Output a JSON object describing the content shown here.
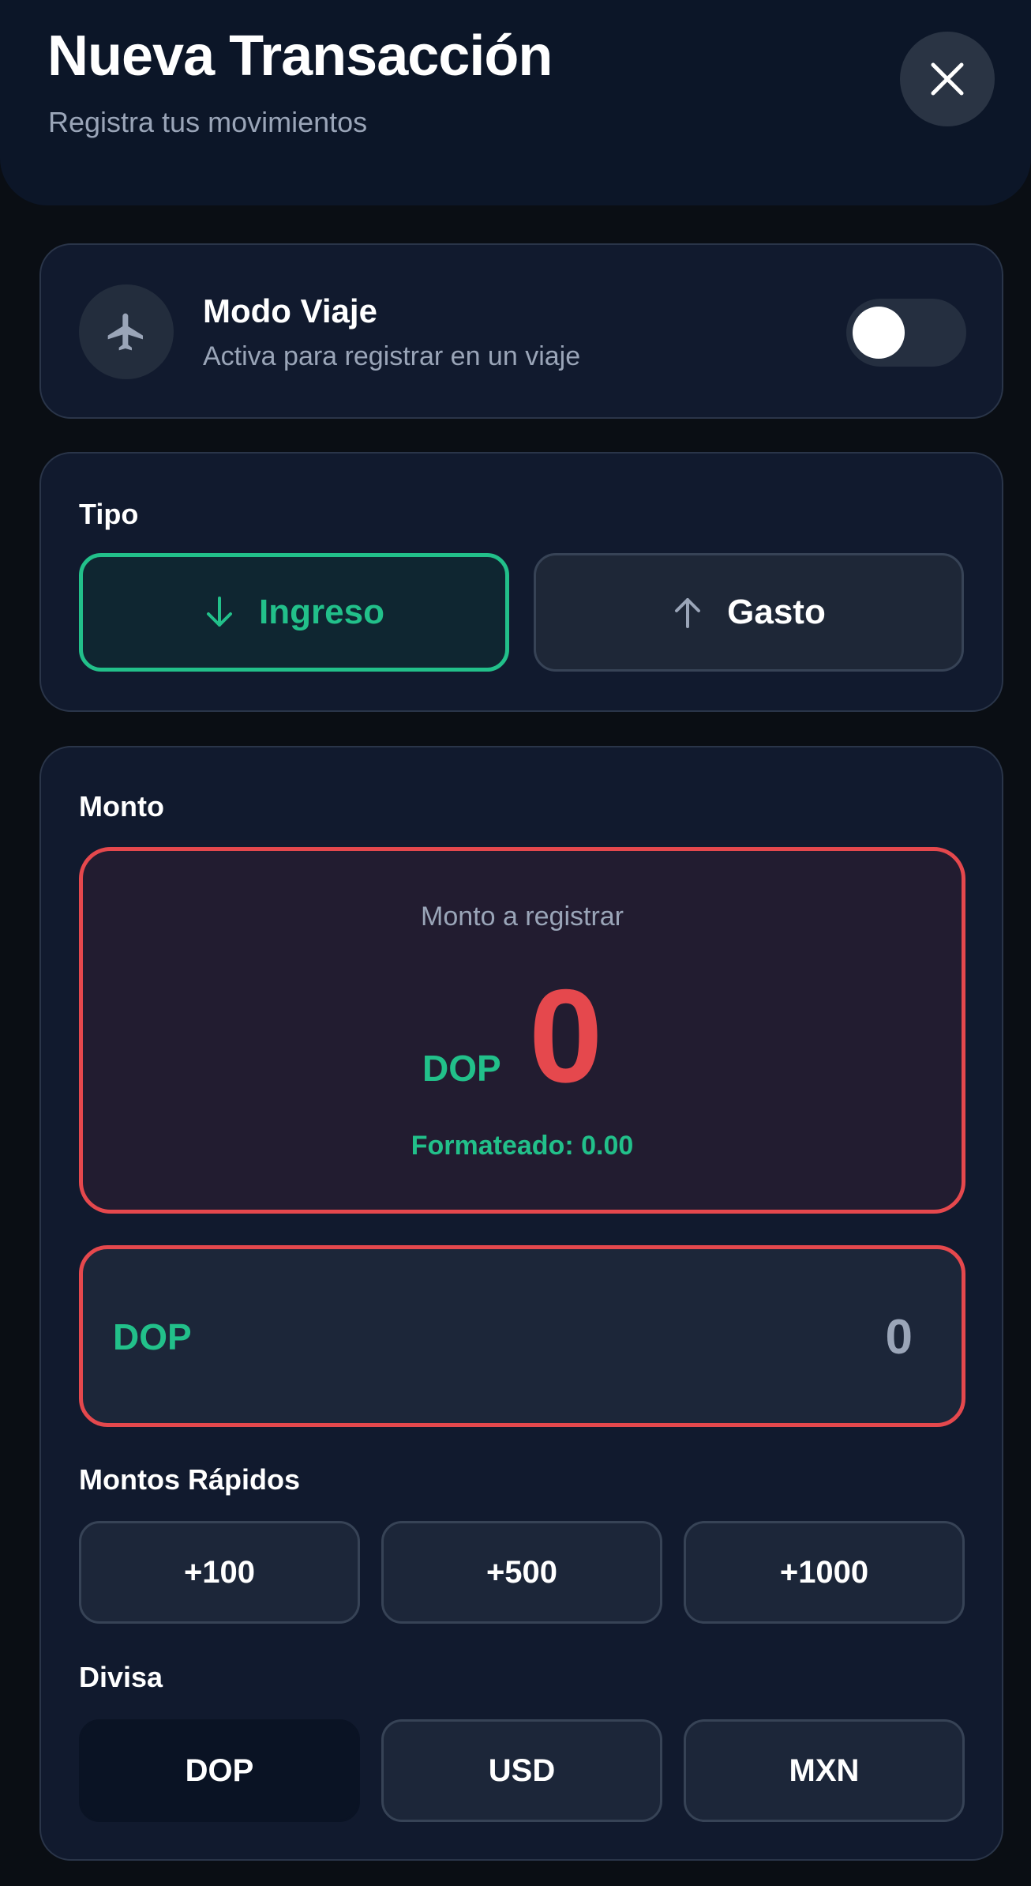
{
  "header": {
    "title": "Nueva Transacción",
    "subtitle": "Registra tus movimientos"
  },
  "travel_mode": {
    "title": "Modo Viaje",
    "subtitle": "Activa para registrar en un viaje",
    "enabled": false
  },
  "type_section": {
    "label": "Tipo",
    "options": [
      {
        "label": "Ingreso",
        "icon": "arrow-down-icon",
        "selected": true
      },
      {
        "label": "Gasto",
        "icon": "arrow-up-icon",
        "selected": false
      }
    ]
  },
  "amount_section": {
    "label": "Monto",
    "hint": "Monto a registrar",
    "currency": "DOP",
    "value": "0",
    "formatted": "Formateado: 0.00",
    "input_currency": "DOP",
    "input_value": "0"
  },
  "quick_amounts": {
    "label": "Montos Rápidos",
    "options": [
      "+100",
      "+500",
      "+1000"
    ]
  },
  "currency_section": {
    "label": "Divisa",
    "options": [
      "DOP",
      "USD",
      "MXN"
    ],
    "selected": "DOP"
  },
  "colors": {
    "accent_green": "#22c08a",
    "error_red": "#e5484d",
    "card_bg": "#111a2e"
  }
}
